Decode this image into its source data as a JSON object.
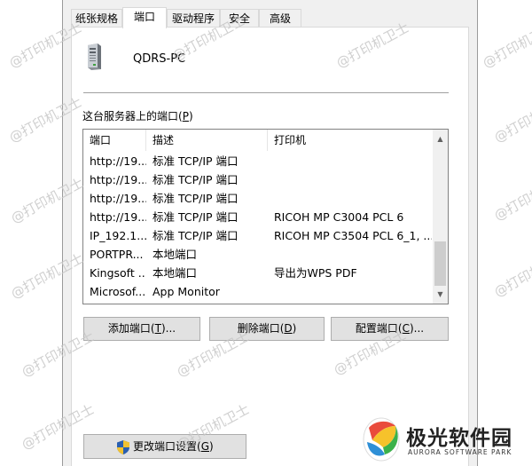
{
  "tabs": [
    {
      "label": "纸张规格"
    },
    {
      "label": "端口"
    },
    {
      "label": "驱动程序"
    },
    {
      "label": "安全"
    },
    {
      "label": "高级"
    }
  ],
  "active_tab": "端口",
  "server": {
    "name": "QDRS-PC",
    "icon": "server-computer-icon"
  },
  "ports_list": {
    "label": "这台服务器上的端口(",
    "label_hotkey": "P",
    "label_close": ")",
    "columns": [
      "端口",
      "描述",
      "打印机"
    ],
    "rows": [
      {
        "port": "http://19...",
        "description": "标准 TCP/IP 端口",
        "printer": ""
      },
      {
        "port": "http://19...",
        "description": "标准 TCP/IP 端口",
        "printer": ""
      },
      {
        "port": "http://19...",
        "description": "标准 TCP/IP 端口",
        "printer": ""
      },
      {
        "port": "http://19...",
        "description": "标准 TCP/IP 端口",
        "printer": "RICOH MP C3004 PCL 6"
      },
      {
        "port": "IP_192.1...",
        "description": "标准 TCP/IP 端口",
        "printer": "RICOH MP C3504 PCL 6_1, ..."
      },
      {
        "port": "PORTPR...",
        "description": "本地端口",
        "printer": ""
      },
      {
        "port": "Kingsoft ...",
        "description": "本地端口",
        "printer": "导出为WPS PDF"
      },
      {
        "port": "Microsof...",
        "description": "App Monitor",
        "printer": ""
      }
    ]
  },
  "buttons": {
    "add": {
      "label": "添加端口(",
      "hotkey": "T",
      "suffix": ")..."
    },
    "delete": {
      "label": "删除端口(",
      "hotkey": "D",
      "suffix": ")"
    },
    "configure": {
      "label": "配置端口(",
      "hotkey": "C",
      "suffix": ")..."
    },
    "change_settings": {
      "label": "更改端口设置(",
      "hotkey": "G",
      "suffix": ")",
      "icon": "uac-shield-icon"
    }
  },
  "watermark": {
    "text": "@打印机卫士"
  },
  "brand": {
    "name": "极光软件园",
    "subtitle": "AURORA SOFTWARE PARK"
  },
  "colors": {
    "panel": "#ffffff",
    "dialog": "#f0f0f0",
    "button": "#e1e1e1",
    "border": "#adadad"
  }
}
